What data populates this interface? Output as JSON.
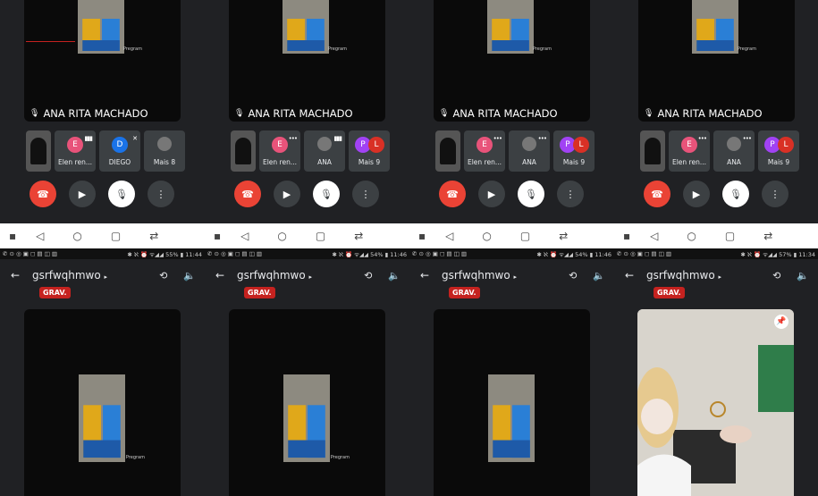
{
  "top_panels": [
    {
      "main_name": "ANA RITA MACHADO",
      "watermark": "Pregram",
      "participants": [
        {
          "type": "self"
        },
        {
          "type": "avatar",
          "letter": "E",
          "color": "#e8537a",
          "label": "Elen ren...",
          "indicator": "▮▮▮"
        },
        {
          "type": "avatar",
          "letter": "D",
          "color": "#1a73e8",
          "label": "DIEGO",
          "indicator": "✕"
        },
        {
          "type": "face",
          "label": "Mais 8"
        }
      ]
    },
    {
      "main_name": "ANA RITA MACHADO",
      "watermark": "Pregram",
      "participants": [
        {
          "type": "self"
        },
        {
          "type": "avatar",
          "letter": "E",
          "color": "#e8537a",
          "label": "Elen ren...",
          "indicator": "•••"
        },
        {
          "type": "face",
          "label": "ANA",
          "indicator": "▮▮▮"
        },
        {
          "type": "double",
          "letters": [
            "P",
            "L"
          ],
          "colors": [
            "#a142f4",
            "#d93025"
          ],
          "label": "Mais 9"
        }
      ]
    },
    {
      "main_name": "ANA RITA MACHADO",
      "watermark": "Pregram",
      "participants": [
        {
          "type": "self"
        },
        {
          "type": "avatar",
          "letter": "E",
          "color": "#e8537a",
          "label": "Elen ren...",
          "indicator": "•••"
        },
        {
          "type": "face",
          "label": "ANA",
          "indicator": "•••"
        },
        {
          "type": "double",
          "letters": [
            "P",
            "L"
          ],
          "colors": [
            "#a142f4",
            "#d93025"
          ],
          "label": "Mais 9"
        }
      ]
    },
    {
      "main_name": "ANA RITA MACHADO",
      "watermark": "Pregram",
      "participants": [
        {
          "type": "self"
        },
        {
          "type": "avatar",
          "letter": "E",
          "color": "#e8537a",
          "label": "Elen ren...",
          "indicator": "•••"
        },
        {
          "type": "face",
          "label": "ANA",
          "indicator": "•••"
        },
        {
          "type": "double",
          "letters": [
            "P",
            "L"
          ],
          "colors": [
            "#a142f4",
            "#d93025"
          ],
          "label": "Mais 9"
        }
      ]
    }
  ],
  "bottom_panels": [
    {
      "status_left": "✆ ⊙ ◎ ▣ ◻ ▤ ◫ ▥",
      "status_right": "✱ ℵ ⏰ ᯤ◢◢ 55% ▮ 11:44",
      "meeting_code": "gsrfwqhmwo",
      "rec_label": "GRAV.",
      "watermark": "Pregram",
      "view": "video"
    },
    {
      "status_left": "✆ ⊙ ◎ ▣ ◻ ▤ ◫ ▥",
      "status_right": "✱ ℵ ⏰ ᯤ◢◢ 54% ▮ 11:46",
      "meeting_code": "gsrfwqhmwo",
      "rec_label": "GRAV.",
      "watermark": "Pregram",
      "view": "video"
    },
    {
      "status_left": "✆ ⊙ ◎ ▣ ◻ ▤ ◫ ▥",
      "status_right": "✱ ℵ ⏰ ᯤ◢◢ 54% ▮ 11:46",
      "meeting_code": "gsrfwqhmwo",
      "rec_label": "GRAV.",
      "watermark": "",
      "view": "video"
    },
    {
      "status_left": "✆ ⊙ ◎ ▣ ◻ ▤ ◫ ▥",
      "status_right": "✱ ℵ ⏰ ᯤ◢◢ 57% ▮ 11:34",
      "meeting_code": "gsrfwqhmwo",
      "rec_label": "GRAV.",
      "watermark": "",
      "view": "camera"
    }
  ],
  "icons": {
    "back": "←",
    "caret": "▸",
    "switch_camera": "⟲",
    "speaker": "🔈",
    "mic_off": "🎙",
    "end_call": "☎",
    "video": "▶",
    "more": "⋮",
    "pin": "📌",
    "nav_dot": "▪",
    "nav_back": "◁",
    "nav_home": "○",
    "nav_recents": "▢",
    "nav_extra": "⇄"
  },
  "colors": {
    "end_call": "#ea4335",
    "rec_badge": "#c5221f",
    "background": "#202124"
  }
}
